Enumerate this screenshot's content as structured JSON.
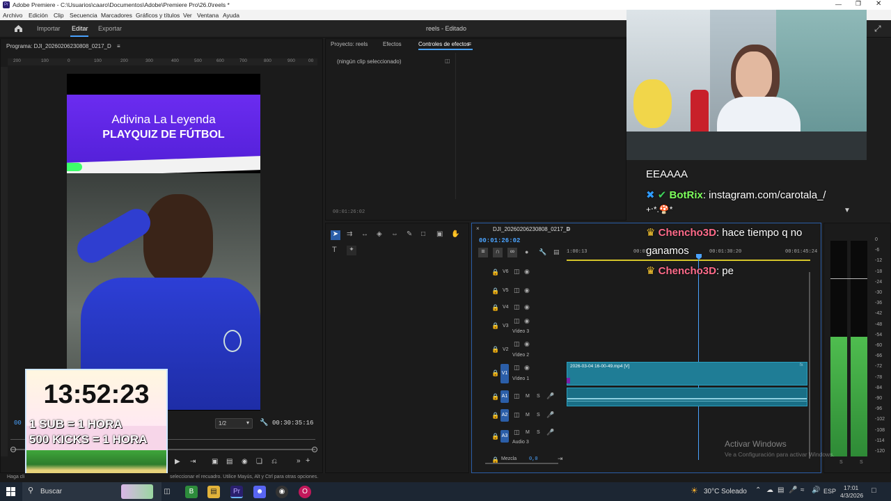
{
  "window": {
    "title": "Adobe Premiere - C:\\Usuarios\\caaro\\Documentos\\Adobe\\Premiere Pro\\26.0\\reels *",
    "app_icon": "Pr"
  },
  "menu": [
    "Archivo",
    "Edición",
    "Clip",
    "Secuencia",
    "Marcadores",
    "Gráficos y títulos",
    "Ver",
    "Ventana",
    "Ayuda"
  ],
  "header": {
    "nav": [
      "Importar",
      "Editar",
      "Exportar"
    ],
    "active": "Editar",
    "project_status": "reels - Editado"
  },
  "program_monitor": {
    "title": "Programa: DJI_20260206230808_0217_D",
    "ruler_ticks": [
      "200",
      "100",
      "0",
      "100",
      "200",
      "300",
      "400",
      "500",
      "600",
      "700",
      "800",
      "900",
      "00"
    ],
    "video_title_line1": "Adivina La Leyenda",
    "video_title_line2": "PLAYQUIZ DE FÚTBOL",
    "zoom": "1/2",
    "duration": "00:30:35:16",
    "current_tc": "00"
  },
  "overlay_timer": {
    "time": "13:52:23",
    "line1": "1 SUB = 1 HORA",
    "line2": "500 KICKS = 1 HORA"
  },
  "effects_panel": {
    "tabs": [
      "Proyecto: reels",
      "Efectos",
      "Controles de efectos"
    ],
    "active_tab": "Controles de efectos",
    "no_clip": "(ningún clip seleccionado)",
    "timecode": "00:01:26:02"
  },
  "timeline": {
    "sequence_name": "DJI_20260206230808_0217_D",
    "timecode": "00:01:26:02",
    "ruler": [
      "1:00:13",
      "00:01",
      "00:01:30:20",
      "00:01:45:24"
    ],
    "tracks_video": [
      {
        "id": "V6",
        "label": ""
      },
      {
        "id": "V5",
        "label": ""
      },
      {
        "id": "V4",
        "label": ""
      },
      {
        "id": "V3",
        "label": "Vídeo 3"
      },
      {
        "id": "V2",
        "label": "Vídeo 2"
      },
      {
        "id": "V1",
        "label": "Vídeo 1"
      }
    ],
    "tracks_audio": [
      {
        "id": "A1",
        "label": ""
      },
      {
        "id": "A2",
        "label": ""
      },
      {
        "id": "A3",
        "label": "Audio 3"
      }
    ],
    "track_buttons": {
      "mute": "M",
      "solo": "S"
    },
    "mix_label": "Mezcla",
    "mix_value": "0,0",
    "clip_name": "2026-03-04 16-00-49.mp4 [V]"
  },
  "meter_scale": [
    "0",
    "-6",
    "-12",
    "-18",
    "-24",
    "-30",
    "-36",
    "-42",
    "-48",
    "-54",
    "-60",
    "-66",
    "-72",
    "-78",
    "-84",
    "-90",
    "-96",
    "-102",
    "-108",
    "-114",
    "-120"
  ],
  "meter_solo": [
    "S",
    "S"
  ],
  "chat": [
    {
      "user": "",
      "text": "EEAAAA"
    },
    {
      "user": "BotRix",
      "text": ": instagram.com/carotala_/"
    },
    {
      "user": "",
      "text": "+‧*.🍄*"
    },
    {
      "user": "Chencho3D",
      "text": ": hace tiempo q no"
    },
    {
      "user": "",
      "text": "ganamos"
    },
    {
      "user": "Chencho3D",
      "text": ": pe"
    }
  ],
  "watermark": {
    "line1": "Activar Windows",
    "line2": "Ve a Configuración para activar Windows."
  },
  "status_bar": {
    "left": "Haga cli",
    "right": "seleccionar el recuadro. Utilice Mayús, Alt y Ctrl para otras opciones."
  },
  "taskbar": {
    "search": "Buscar",
    "weather": "30°C  Soleado",
    "lang": "ESP",
    "time": "17:01",
    "date": "4/3/2026"
  },
  "colors": {
    "accent_blue": "#2b5ea8",
    "clip_teal": "#1f7d96",
    "timecode_blue": "#4aa3ff",
    "meter_green": "#47b04b"
  }
}
